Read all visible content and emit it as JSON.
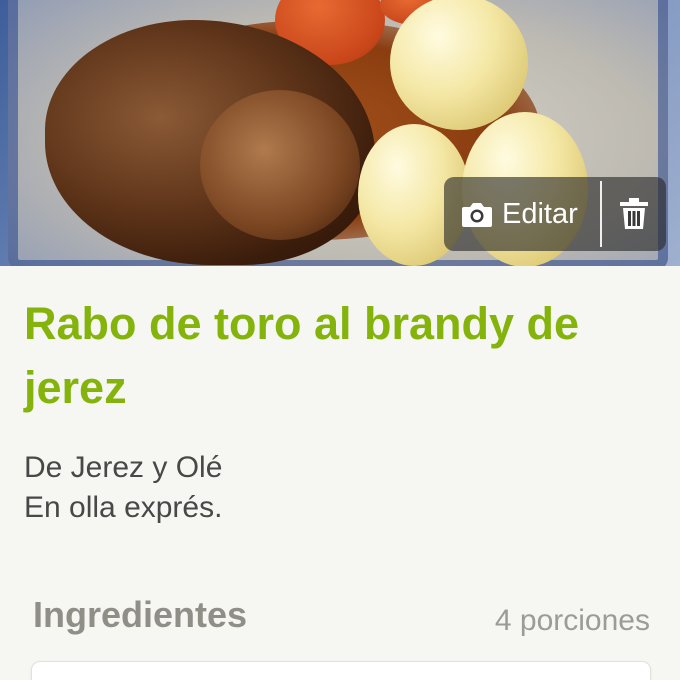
{
  "recipe": {
    "title": "Rabo de toro al brandy de jerez",
    "description_lines": [
      "De Jerez y Olé",
      "En olla exprés."
    ]
  },
  "photo_actions": {
    "edit_label": "Editar",
    "edit_icon": "camera-icon",
    "delete_icon": "trash-icon"
  },
  "ingredients": {
    "header": "Ingredientes",
    "portions": "4 porciones"
  },
  "colors": {
    "title": "#84b40c",
    "section_header": "#8f8f87",
    "background": "#f6f6f2"
  }
}
